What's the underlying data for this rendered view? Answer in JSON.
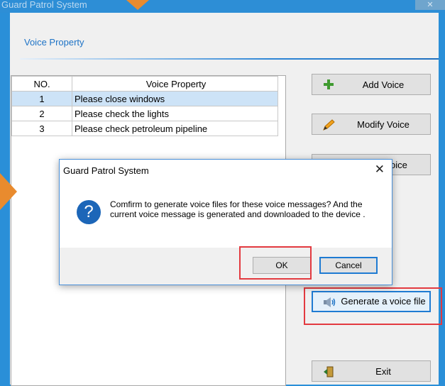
{
  "window": {
    "title": "Guard Patrol System",
    "close_label": "✕"
  },
  "section": {
    "title": "Voice Property"
  },
  "table": {
    "columns": [
      "NO.",
      "Voice Property"
    ],
    "rows": [
      {
        "no": "1",
        "text": "Please close windows",
        "selected": true
      },
      {
        "no": "2",
        "text": "Please check the lights",
        "selected": false
      },
      {
        "no": "3",
        "text": "Please check petroleum pipeline",
        "selected": false
      }
    ]
  },
  "buttons": {
    "add_voice": {
      "label": "Add Voice",
      "icon": "plus-icon"
    },
    "modify_voice": {
      "label": "Modify Voice",
      "icon": "pencil-icon"
    },
    "delete_voice_partial": {
      "label": "oice"
    },
    "generate": {
      "label": "Generate a voice file",
      "icon": "speaker-icon"
    },
    "exit": {
      "label": "Exit",
      "icon": "exit-door-icon"
    }
  },
  "dialog": {
    "title": "Guard Patrol System",
    "close_label": "✕",
    "icon": "question-icon",
    "message": "Comfirm to generate voice files for these voice messages? And the current voice message is generated and downloaded to the device .",
    "ok_label": "OK",
    "cancel_label": "Cancel"
  },
  "colors": {
    "accent": "#1e73c6",
    "highlight": "#e33a40",
    "annotation_arrow": "#e98b2e",
    "selected_row": "#cde3f7"
  }
}
